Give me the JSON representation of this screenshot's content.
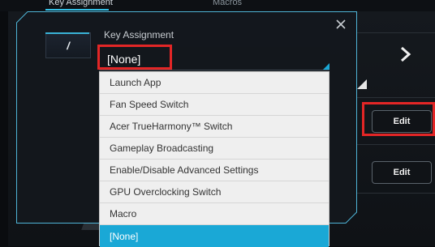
{
  "background": {
    "tabs": [
      "Key Assignment",
      "Macros"
    ],
    "edit_buttons": [
      "Edit",
      "Edit"
    ]
  },
  "modal": {
    "key_label": "/",
    "title": "Key Assignment",
    "selected_value": "[None]",
    "options": [
      "Launch App",
      "Fan Speed Switch",
      "Acer TrueHarmony™ Switch",
      "Gameplay Broadcasting",
      "Enable/Disable Advanced Settings",
      "GPU Overclocking Switch",
      "Macro",
      "[None]"
    ],
    "selected_index": 7
  },
  "colors": {
    "accent": "#1aa8d6",
    "highlight": "#e32626",
    "modal_border": "#3a7c93"
  }
}
